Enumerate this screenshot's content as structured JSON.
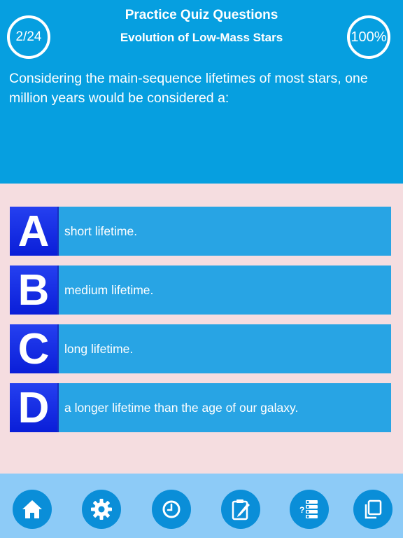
{
  "header": {
    "title": "Practice Quiz Questions",
    "subtitle": "Evolution of Low-Mass Stars",
    "progress": "2/24",
    "score": "100%",
    "question": "Considering the main-sequence lifetimes of most stars, one million years would be considered a:"
  },
  "answers": [
    {
      "letter": "A",
      "text": "short lifetime."
    },
    {
      "letter": "B",
      "text": "medium lifetime."
    },
    {
      "letter": "C",
      "text": "long lifetime."
    },
    {
      "letter": "D",
      "text": "a longer lifetime than the age of our galaxy."
    }
  ],
  "footer": {
    "icons": [
      "home-icon",
      "gear-icon",
      "clock-icon",
      "notepad-icon",
      "question-list-icon",
      "copy-icon"
    ]
  },
  "colors": {
    "header_bg": "#069fe0",
    "answer_bg": "#28a4e4",
    "letter_bg": "#0a1ed8",
    "content_bg": "#f5dde0",
    "footer_bg": "#8dcbf7",
    "footer_button": "#0a8ed8"
  }
}
